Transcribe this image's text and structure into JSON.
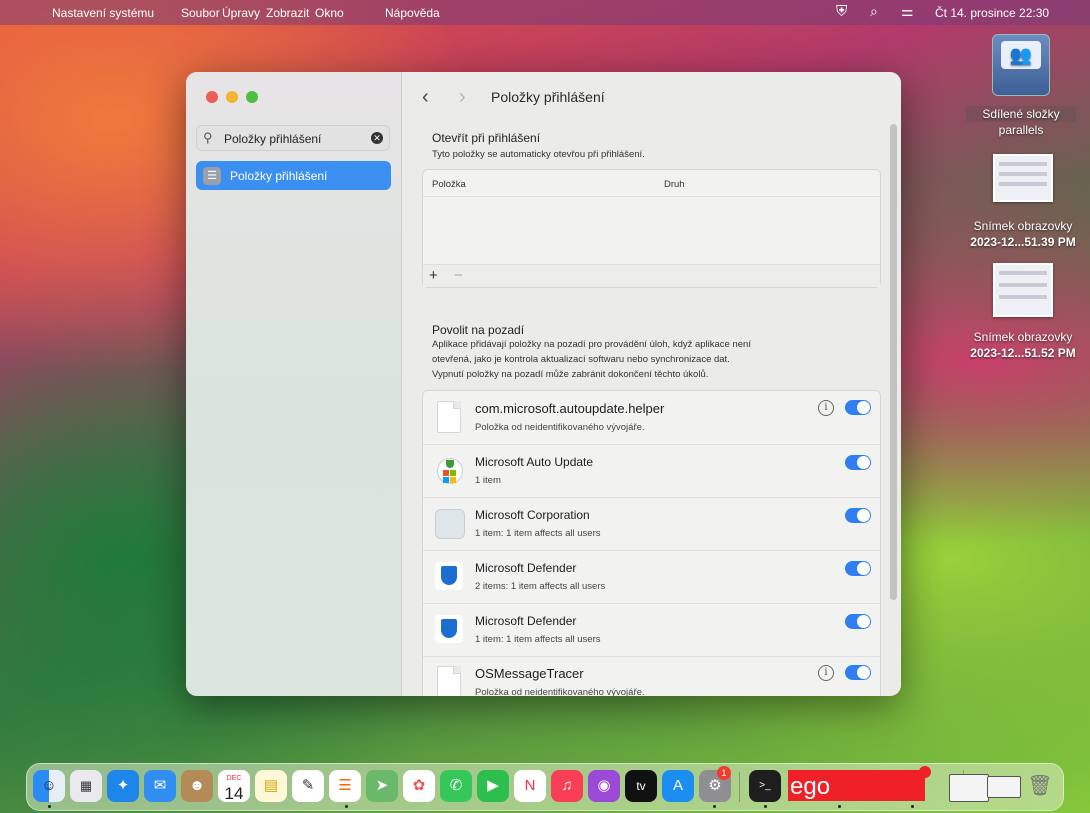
{
  "menubar": {
    "app_name": "Nastavení systému",
    "menus": [
      "Soubor",
      "Úpravy",
      "Zobrazit",
      "Okno",
      "Nápověda"
    ],
    "clock": "Čt 14. prosince  22:30"
  },
  "desktop": {
    "share": {
      "line1": "Sdílené složky",
      "line2": "parallels"
    },
    "shot1": {
      "line1": "Snímek obrazovky",
      "line2": "2023-12...51.39 PM"
    },
    "shot2": {
      "line1": "Snímek obrazovky",
      "line2": "2023-12...51.52 PM"
    }
  },
  "sidebar": {
    "search_value": "Položky přihlášení",
    "item_label": "Položky přihlášení"
  },
  "content": {
    "title": "Položky přihlášení",
    "open_section": {
      "title": "Otevřít při přihlášení",
      "subtitle": "Tyto položky se automaticky otevřou při přihlášení."
    },
    "table": {
      "col1": "Položka",
      "col2": "Druh",
      "add": "+",
      "remove": "−"
    },
    "bg_section": {
      "title": "Povolit na pozadí",
      "desc1": "Aplikace přidávají položky na pozadí pro provádění úloh, když aplikace není",
      "desc2": "otevřená, jako je kontrola aktualizací softwaru nebo synchronizace dat.",
      "desc3": "Vypnutí položky na pozadí může zabránit dokončení těchto úkolů."
    },
    "items": [
      {
        "name": "com.microsoft.autoupdate.helper",
        "desc": "Položka od neidentifikovaného vývojáře.",
        "enabled": true,
        "icon": "document-icon"
      },
      {
        "name": "Microsoft Auto Update",
        "desc": "1 item",
        "enabled": true,
        "icon": "microsoft-autoupdate-icon"
      },
      {
        "name": "Microsoft Corporation",
        "desc": "1 item: 1 item affects all users",
        "enabled": true,
        "icon": "microsoft-corporation-icon"
      },
      {
        "name": "Microsoft Defender",
        "desc": "2 items: 1 item affects all users",
        "enabled": true,
        "icon": "defender-shield-icon"
      },
      {
        "name": "Microsoft Defender",
        "desc": "1 item: 1 item affects all users",
        "enabled": true,
        "icon": "defender-shield-icon"
      },
      {
        "name": "OSMessageTracer",
        "desc": "Položka od neidentifikovaného vývojáře.",
        "enabled": true,
        "icon": "document-icon"
      }
    ]
  },
  "dock": {
    "calendar_month": "DEC",
    "calendar_day": "14",
    "settings_badge": "1",
    "tv_label": "tv",
    "redacted_text": "ego"
  },
  "colors": {
    "accent": "#3b8ff0",
    "toggle": "#2f7ff2"
  }
}
